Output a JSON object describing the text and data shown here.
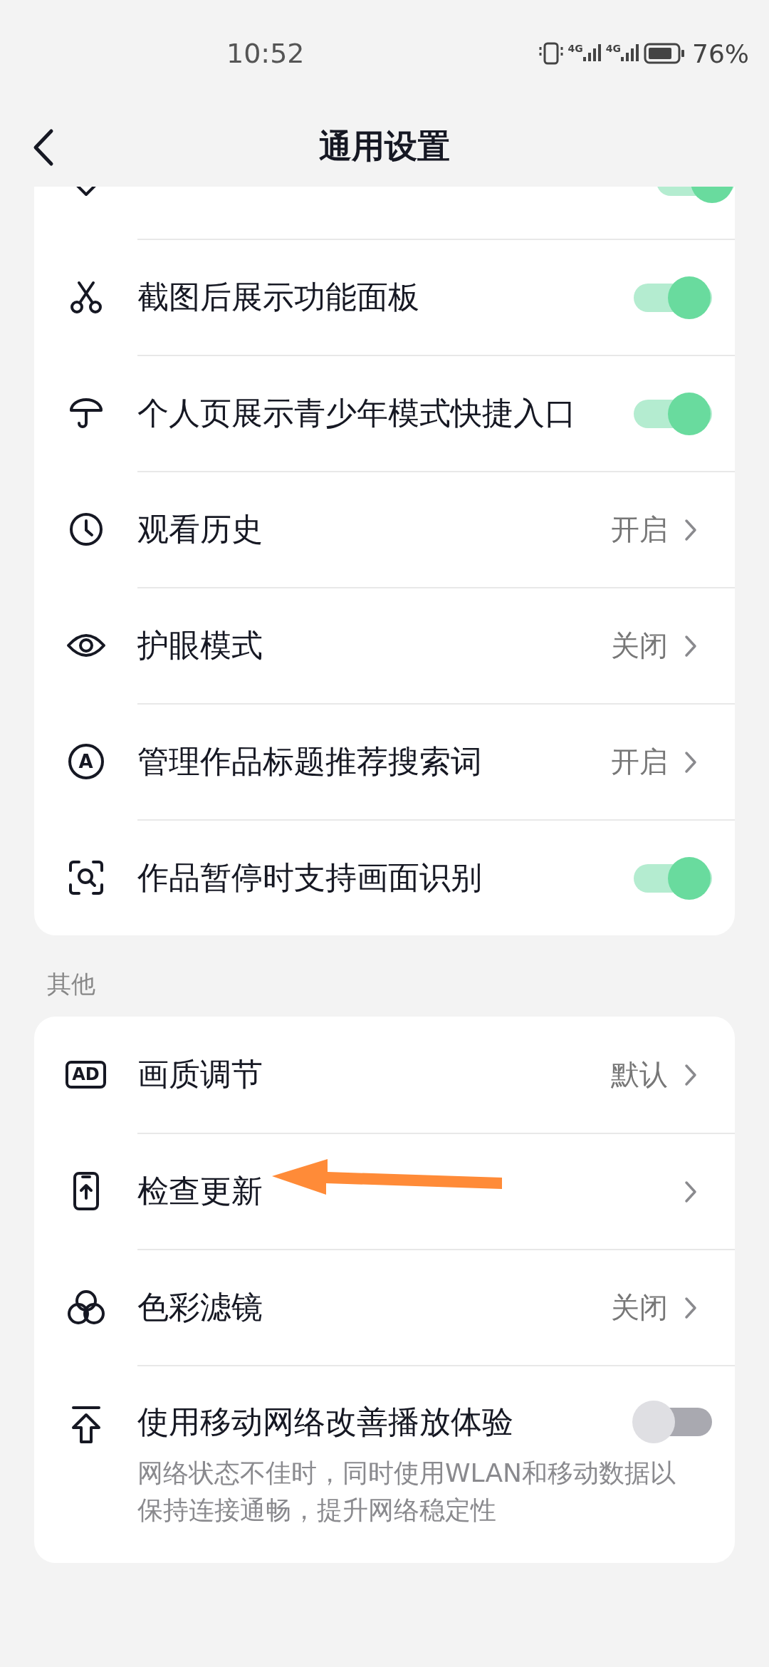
{
  "status_bar": {
    "time": "10:52",
    "signals": [
      "4G",
      "4G"
    ],
    "battery": "76%"
  },
  "header": {
    "title": "通用设置"
  },
  "groups": [
    {
      "scrolled_row": {
        "kind": "toggle",
        "on": true
      },
      "rows": [
        {
          "kind": "toggle",
          "label": "截图后展示功能面板",
          "on": true
        },
        {
          "kind": "toggle",
          "label": "个人页展示青少年模式快捷入口",
          "on": true
        },
        {
          "kind": "link",
          "label": "观看历史",
          "value": "开启"
        },
        {
          "kind": "link",
          "label": "护眼模式",
          "value": "关闭"
        },
        {
          "kind": "link",
          "label": "管理作品标题推荐搜索词",
          "value": "开启",
          "badge": "A"
        },
        {
          "kind": "toggle",
          "label": "作品暂停时支持画面识别",
          "on": true
        }
      ]
    },
    {
      "title": "其他",
      "rows": [
        {
          "kind": "link",
          "label": "画质调节",
          "value": "默认",
          "badge": "AD"
        },
        {
          "kind": "link",
          "label": "检查更新"
        },
        {
          "kind": "link",
          "label": "色彩滤镜",
          "value": "关闭"
        },
        {
          "kind": "toggle",
          "label": "使用移动网络改善播放体验",
          "on": false,
          "description": "网络状态不佳时，同时使用WLAN和移动数据以保持连接通畅，提升网络稳定性"
        }
      ]
    }
  ]
}
